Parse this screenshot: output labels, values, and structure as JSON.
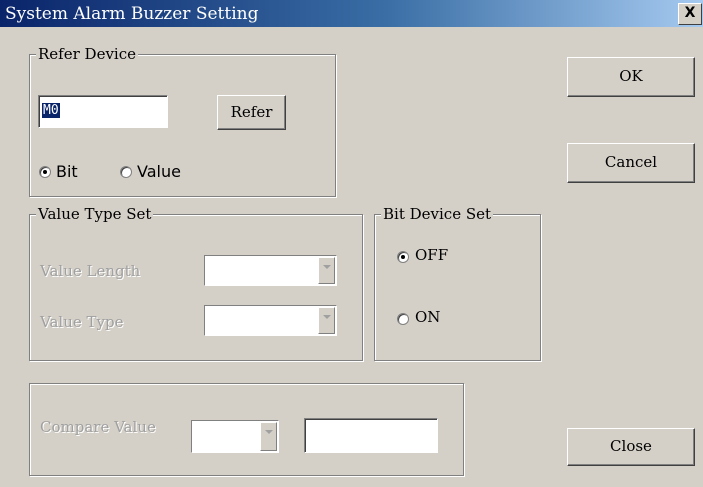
{
  "window": {
    "title": "System Alarm Buzzer Setting",
    "close_glyph": "X"
  },
  "refer_device": {
    "legend": "Refer Device",
    "device_value": "M0",
    "refer_button": "Refer",
    "radio_bit": "Bit",
    "radio_value": "Value",
    "selected": "Bit"
  },
  "value_type_set": {
    "legend": "Value Type Set",
    "length_label": "Value Length",
    "type_label": "Value Type",
    "length_value": "",
    "type_value": ""
  },
  "bit_device_set": {
    "legend": "Bit Device Set",
    "off_label": "OFF",
    "on_label": "ON",
    "selected": "OFF"
  },
  "compare": {
    "label": "Compare Value",
    "operator_value": "",
    "value": ""
  },
  "buttons": {
    "ok": "OK",
    "cancel": "Cancel",
    "close": "Close"
  }
}
